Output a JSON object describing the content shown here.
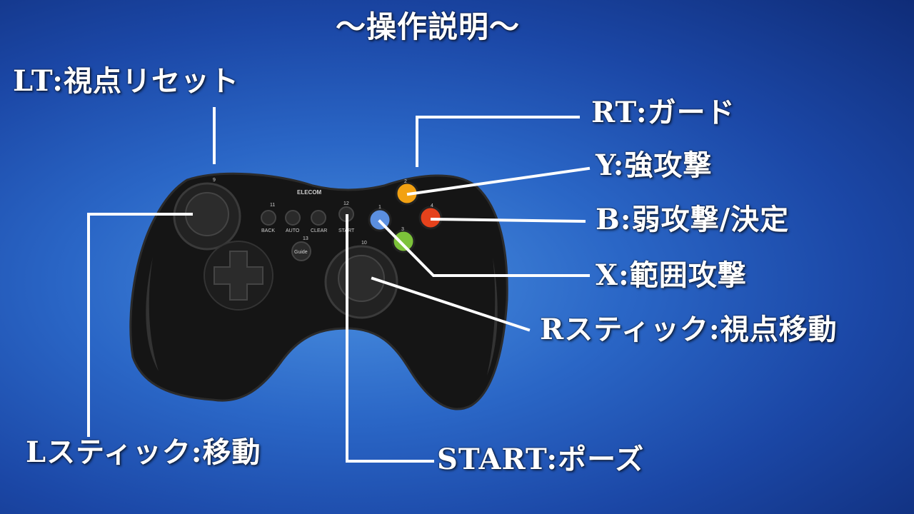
{
  "title": "～操作説明～",
  "controller": {
    "brand": "ELECOM",
    "buttons": {
      "back": "BACK",
      "auto": "AUTO",
      "clear": "CLEAR",
      "start": "START",
      "guide": "Guide",
      "n11": "11",
      "n12": "12",
      "n13": "13",
      "n10": "10",
      "n9": "9",
      "n1": "1",
      "n2": "2",
      "n3": "3",
      "n4": "4"
    }
  },
  "labels": {
    "lt": "LT:視点リセット",
    "rt": "RT:ガード",
    "y": "Y:強攻撃",
    "b": "B:弱攻撃/決定",
    "x": "X:範囲攻撃",
    "r_stick": "Rスティック:視点移動",
    "l_stick": "Lスティック:移動",
    "start": "START:ポーズ"
  },
  "colors": {
    "button_y": "#f2a112",
    "button_b": "#e5421c",
    "button_x": "#5b8fe0",
    "button_a": "#7cc23a"
  }
}
